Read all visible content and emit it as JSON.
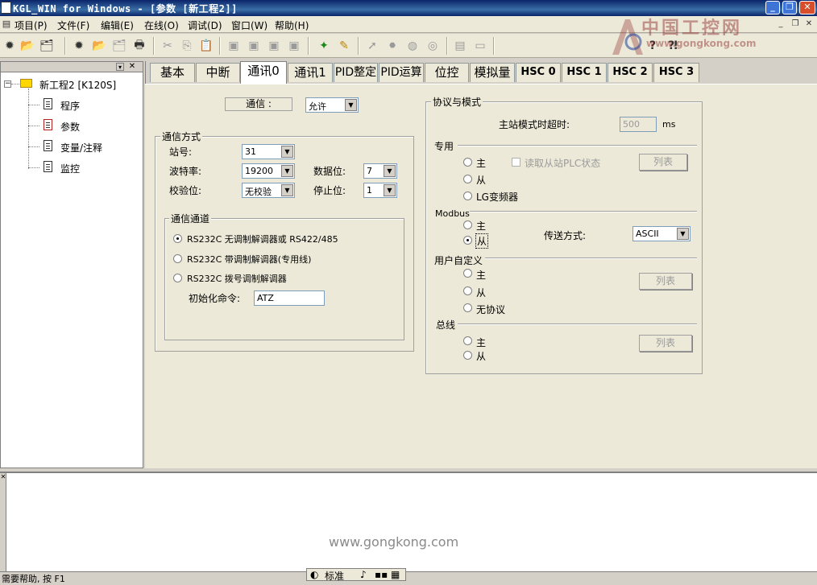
{
  "window": {
    "title": "KGL_WIN for Windows - [参数 [新工程2]]"
  },
  "menu": [
    "项目(P)",
    "文件(F)",
    "编辑(E)",
    "在线(O)",
    "调试(D)",
    "窗口(W)",
    "帮助(H)"
  ],
  "logo": {
    "text": "中国工控网",
    "url": "www.gongkong.com"
  },
  "tree": {
    "root": "新工程2 [K120S]",
    "items": [
      "程序",
      "参数",
      "变量/注释",
      "监控"
    ]
  },
  "tabs": [
    "基本",
    "中断",
    "通讯0",
    "通讯1",
    "PID整定",
    "PID运算",
    "位控",
    "模拟量",
    "HSC 0",
    "HSC 1",
    "HSC 2",
    "HSC 3"
  ],
  "active_tab": "通讯0",
  "comm": {
    "enable_label": "通信 :",
    "enable_value": "允许",
    "method": {
      "title": "通信方式",
      "station_label": "站号:",
      "station_value": "31",
      "baud_label": "波特率:",
      "baud_value": "19200",
      "databits_label": "数据位:",
      "databits_value": "7",
      "parity_label": "校验位:",
      "parity_value": "无校验",
      "stopbits_label": "停止位:",
      "stopbits_value": "1"
    },
    "channel": {
      "title": "通信通道",
      "opt1": "RS232C 无调制解调器或 RS422/485",
      "opt2": "RS232C 带调制解调器(专用线)",
      "opt3": "RS232C 拨号调制解调器",
      "selected": "opt1",
      "init_label": "初始化命令:",
      "init_value": "ATZ"
    }
  },
  "protocol": {
    "title": "协议与模式",
    "timeout_label": "主站模式时超时:",
    "timeout_value": "500",
    "timeout_unit": "ms",
    "dedicated": {
      "title": "专用",
      "master": "主",
      "slave": "从",
      "lg": "LG变频器",
      "read_status": "读取从站PLC状态",
      "list_btn": "列表"
    },
    "modbus": {
      "title": "Modbus",
      "master": "主",
      "slave": "从",
      "selected": "slave",
      "trans_label": "传送方式:",
      "trans_value": "ASCII"
    },
    "user": {
      "title": "用户自定义",
      "master": "主",
      "slave": "从",
      "none": "无协议",
      "list_btn": "列表"
    },
    "bus": {
      "title": "总线",
      "master": "主",
      "slave": "从",
      "list_btn": "列表"
    }
  },
  "watermark": "www.gongkong.com",
  "status": {
    "text": "需要帮助, 按 F1",
    "ime": "标准"
  }
}
